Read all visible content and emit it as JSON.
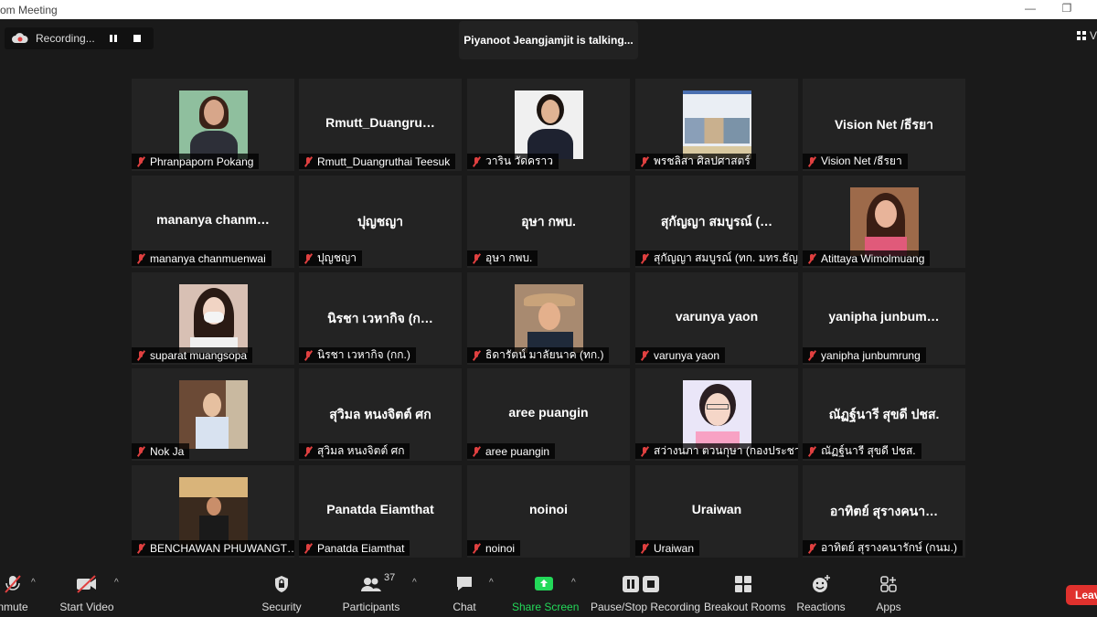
{
  "window": {
    "title": "om Meeting",
    "minimize_glyph": "—",
    "restore_glyph": "❐"
  },
  "recording": {
    "label": "Recording..."
  },
  "talking": {
    "text": "Piyanoot Jeangjamjit is talking..."
  },
  "view": {
    "label": "V"
  },
  "tiles": [
    {
      "big": "",
      "label": "Phranpaporn Pokang",
      "photo": "woman1"
    },
    {
      "big": "Rmutt_Duangru…",
      "label": "Rmutt_Duangruthai Teesuk"
    },
    {
      "big": "",
      "label": "วาริน วัดคราว",
      "photo": "woman2"
    },
    {
      "big": "",
      "label": "พรชลิสา ศิลปศาสตร์",
      "photo": "doc"
    },
    {
      "big": "Vision Net /ธีรยา",
      "label": "Vision Net /ธีรยา"
    },
    {
      "big": "mananya  chanm…",
      "label": "mananya chanmuenwai"
    },
    {
      "big": "ปุญชญา",
      "label": "ปุญชญา"
    },
    {
      "big": "อุษา กพบ.",
      "label": "อุษา กพบ."
    },
    {
      "big": "สุกัญญา สมบูรณ์ (…",
      "label": "สุกัญญา สมบูรณ์ (ทก. มทร.ธัญ…"
    },
    {
      "big": "",
      "label": "Atittaya Wimolmuang",
      "photo": "girl"
    },
    {
      "big": "",
      "label": "suparat muangsopa",
      "photo": "mask"
    },
    {
      "big": "นิรชา  เวหากิจ (ก…",
      "label": "นิรชา  เวหากิจ (กก.)"
    },
    {
      "big": "",
      "label": "ธิดารัตน์ มาลัยนาค (ทก.)",
      "photo": "hat"
    },
    {
      "big": "varunya  yaon",
      "label": "varunya  yaon"
    },
    {
      "big": "yanipha  junbum…",
      "label": "yanipha junbumrung"
    },
    {
      "big": "",
      "label": "Nok Ja",
      "photo": "nok"
    },
    {
      "big": "สุวิมล หนงจิตต์ ศก",
      "label": "สุวิมล หนงจิตต์ ศก"
    },
    {
      "big": "aree puangin",
      "label": "aree puangin"
    },
    {
      "big": "",
      "label": "สว่างนภา ตวนกุษา (กองประชาสั…",
      "photo": "glasses"
    },
    {
      "big": "ณัฏฐ์นารี สุขดี ปชส.",
      "label": "ณัฏฐ์นารี สุขดี ปชส."
    },
    {
      "big": "",
      "label": "BENCHAWAN PHUWANGT…",
      "photo": "bench"
    },
    {
      "big": "Panatda Eiamthat",
      "label": "Panatda Eiamthat"
    },
    {
      "big": "noinoi",
      "label": "noinoi"
    },
    {
      "big": "Uraiwan",
      "label": "Uraiwan"
    },
    {
      "big": "อาทิตย์ สุรางคนา…",
      "label": "อาทิตย์ สุรางคนารักษ์ (กนม.)"
    }
  ],
  "toolbar": {
    "unmute": "nmute",
    "start_video": "Start Video",
    "security": "Security",
    "participants": "Participants",
    "participants_count": "37",
    "chat": "Chat",
    "share_screen": "Share Screen",
    "record": "Pause/Stop Recording",
    "breakout": "Breakout Rooms",
    "reactions": "Reactions",
    "apps": "Apps",
    "leave": "Leav"
  },
  "colors": {
    "share_green": "#23d959",
    "leave_red": "#e0312d",
    "muted_red": "#e04040"
  }
}
